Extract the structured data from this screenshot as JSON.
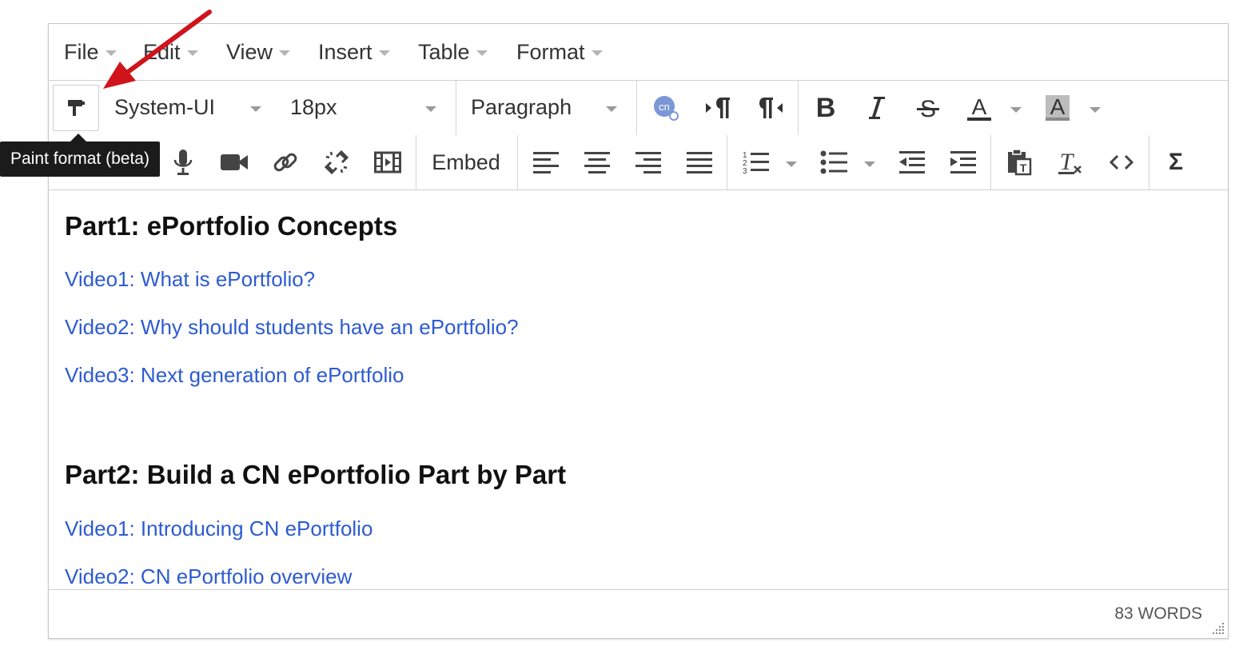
{
  "menubar": {
    "items": [
      {
        "label": "File"
      },
      {
        "label": "Edit"
      },
      {
        "label": "View"
      },
      {
        "label": "Insert"
      },
      {
        "label": "Table"
      },
      {
        "label": "Format"
      }
    ]
  },
  "toolbar": {
    "font_family": "System-UI",
    "font_size": "18px",
    "block_format": "Paragraph",
    "embed_label": "Embed",
    "tooltip": "Paint format (beta)",
    "icons": {
      "paint_format": "paint-format-icon",
      "cn_link": "cn-link-icon",
      "ltr": "left-to-right-icon",
      "rtl": "right-to-left-icon",
      "bold": "bold-icon",
      "italic": "italic-icon",
      "strike": "strikethrough-icon",
      "text_color": "text-color-icon",
      "bg_color": "background-color-icon"
    }
  },
  "content": {
    "part1_heading": "Part1: ePortfolio Concepts",
    "part1_links": [
      "Video1: What is ePortfolio?",
      "Video2: Why should students have an ePortfolio?",
      "Video3: Next generation of ePortfolio"
    ],
    "part2_heading": "Part2: Build a CN ePortfolio Part by Part",
    "part2_links": [
      "Video1: Introducing CN ePortfolio",
      "Video2: CN ePortfolio overview"
    ]
  },
  "statusbar": {
    "word_count": "83 WORDS"
  },
  "colors": {
    "link": "#2d5bd0",
    "annotation_arrow": "#d0141b",
    "tooltip_bg": "#1b1b1b"
  }
}
